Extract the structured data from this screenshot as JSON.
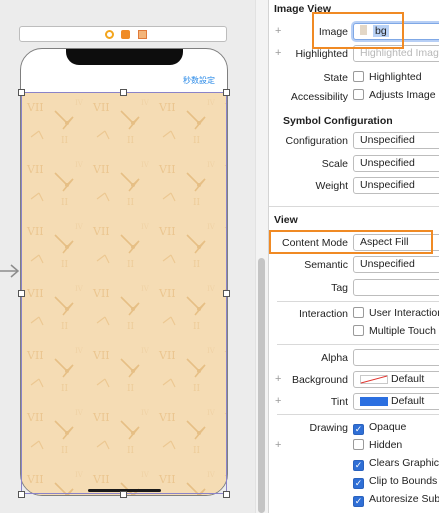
{
  "canvas": {
    "dock_icons": [
      "view-controller-icon",
      "first-responder-icon",
      "exit-icon"
    ],
    "nav_right_text": "秒数設定",
    "background": {
      "color": "#f5dcb4",
      "pattern_color": "#ecc892"
    }
  },
  "inspector": {
    "accent_color": "#f08a24",
    "image_view": {
      "title": "Image View",
      "image": {
        "label": "Image",
        "value": "bg"
      },
      "highlighted": {
        "label": "Highlighted",
        "placeholder": "Highlighted Image"
      },
      "state": {
        "label": "State",
        "checkbox": "Highlighted",
        "checked": false
      },
      "accessibility": {
        "label": "Accessibility",
        "checkbox": "Adjusts Image Size",
        "checked": false
      }
    },
    "symbol_configuration": {
      "title": "Symbol Configuration",
      "configuration": {
        "label": "Configuration",
        "value": "Unspecified"
      },
      "scale": {
        "label": "Scale",
        "value": "Unspecified"
      },
      "weight": {
        "label": "Weight",
        "value": "Unspecified"
      }
    },
    "view": {
      "title": "View",
      "content_mode": {
        "label": "Content Mode",
        "value": "Aspect Fill"
      },
      "semantic": {
        "label": "Semantic",
        "value": "Unspecified"
      },
      "tag": {
        "label": "Tag",
        "value": ""
      },
      "interaction": {
        "label": "Interaction",
        "options": [
          {
            "text": "User Interaction Enabled",
            "checked": false
          },
          {
            "text": "Multiple Touch",
            "checked": false
          }
        ]
      },
      "alpha": {
        "label": "Alpha",
        "value": ""
      },
      "background": {
        "label": "Background",
        "value": "Default"
      },
      "tint": {
        "label": "Tint",
        "value": "Default",
        "color": "#2b6fe0"
      },
      "drawing": {
        "label": "Drawing",
        "options": [
          {
            "text": "Opaque",
            "checked": true
          },
          {
            "text": "Hidden",
            "checked": false
          },
          {
            "text": "Clears Graphics Context",
            "checked": true
          },
          {
            "text": "Clip to Bounds",
            "checked": true
          },
          {
            "text": "Autoresize Subviews",
            "checked": true
          }
        ]
      }
    }
  }
}
